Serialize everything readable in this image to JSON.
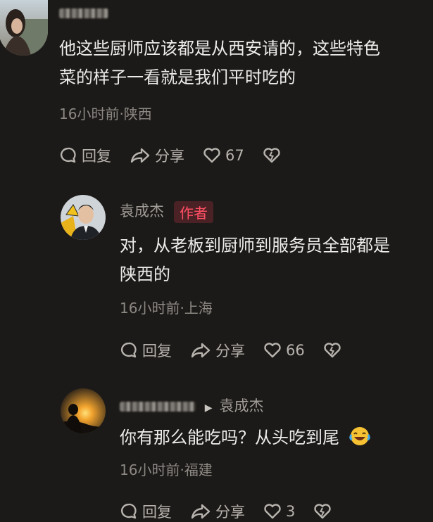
{
  "comments": [
    {
      "username": "",
      "text_line1": "他这些厨师应该都是从西安请的，这些特色",
      "text_line2": "菜的样子一看就是我们平时吃的",
      "meta": "16小时前·陕西",
      "reply_label": "回复",
      "share_label": "分享",
      "likes": "67"
    },
    {
      "username": "袁成杰",
      "badge": "作者",
      "text_line1": "对，从老板到厨师到服务员全部都是",
      "text_line2": "陕西的",
      "meta": "16小时前·上海",
      "reply_label": "回复",
      "share_label": "分享",
      "likes": "66"
    },
    {
      "username": "",
      "reply_to": "袁成杰",
      "text": "你有那么能吃吗？从头吃到尾",
      "meta": "16小时前·福建",
      "reply_label": "回复",
      "share_label": "分享",
      "likes": "3"
    }
  ],
  "colors": {
    "background": "#1c1a18",
    "badge_text": "#ff4f63",
    "badge_bg": "#4a2226"
  },
  "icons": [
    "reply-bubble-icon",
    "share-arrow-icon",
    "heart-icon",
    "broken-heart-icon",
    "laughing-emoji-icon"
  ]
}
